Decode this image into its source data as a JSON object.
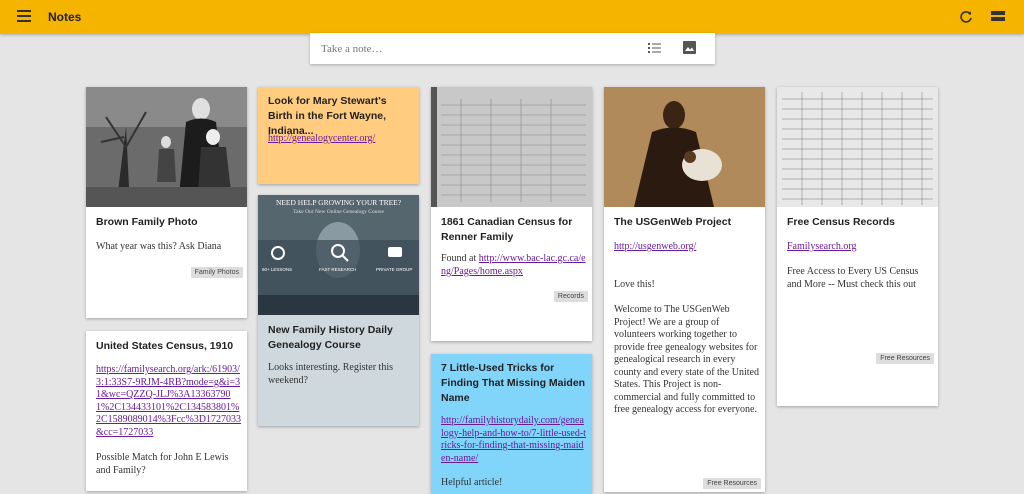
{
  "app": {
    "title": "Notes"
  },
  "takenote": {
    "placeholder": "Take a note…"
  },
  "cards": {
    "brown": {
      "title": "Brown Family Photo",
      "body": "What year was this? Ask Diana",
      "label": "Family Photos"
    },
    "census1910": {
      "title": "United States Census, 1910",
      "link": "https://familysearch.org/ark:/61903/3:1:33S7-9RJM-4RB?mode=g&i=31&wc=QZZQ-JLJ%3A133637901%2C134433101%2C134583801%2C1589089014%3Fcc%3D1727033&cc=1727033",
      "body": "Possible Match for John E Lewis and Family?"
    },
    "mary": {
      "title": "Look for Mary Stewart's Birth in the Fort Wayne, Indiana...",
      "link": "http://genealogycenter.org/"
    },
    "course": {
      "title": "New Family History Daily Genealogy Course",
      "body": "Looks interesting. Register this weekend?",
      "banner_top": "NEED HELP GROWING YOUR TREE?",
      "banner_sub": "Take Our New Online Genealogy Course",
      "features": [
        "60+ LESSONS",
        "FAST RESEARCH",
        "PRIVATE GROUP"
      ]
    },
    "canadian": {
      "title": "1861 Canadian Census for Renner Family",
      "body_prefix": "Found at ",
      "link": "http://www.bac-lac.gc.ca/eng/Pages/home.aspx",
      "label": "Records"
    },
    "maiden": {
      "title": "7 Little-Used Tricks for Finding That Missing Maiden Name",
      "link": "http://familyhistorydaily.com/genealogy-help-and-how-to/7-little-used-tricks-for-finding-that-missing-maiden-name/",
      "body": "Helpful article!"
    },
    "usgenweb": {
      "title": "The USGenWeb Project",
      "link": "http://usgenweb.org/",
      "body1": "Love this!",
      "body2": "Welcome to The USGenWeb Project! We are a group of volunteers working together to provide free genealogy websites for genealogical research in every county and every state of the United States. This Project is non-commercial and fully committed to free genealogy access for everyone.",
      "label": "Free Resources"
    },
    "freecensus": {
      "title": "Free Census Records",
      "link": "Familysearch.org",
      "body": "Free Access to Every US Census and More -- Must check this out",
      "label": "Free Resources"
    }
  },
  "icons": {
    "menu": "menu-icon",
    "refresh": "refresh-icon",
    "grid": "grid-view-icon",
    "list": "list-icon",
    "image": "image-icon"
  },
  "colors": {
    "topbar": "#f4b400",
    "yellow_card": "#ffcc80",
    "grey_card": "#cfd8dc",
    "blue_card": "#81d4fa",
    "link": "#6a1b9a"
  }
}
